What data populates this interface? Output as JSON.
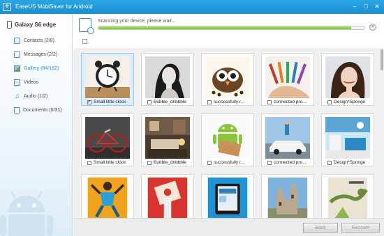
{
  "window": {
    "title": "EaseUS MobiSaver for Android",
    "logo_glyph": "+",
    "controls": {
      "minimize": "–",
      "maximize": "□",
      "close": "✕"
    }
  },
  "sidebar": {
    "device": "Galaxy S6 edge",
    "items": [
      {
        "label": "Contacts (2/8)",
        "icon": "contacts-icon"
      },
      {
        "label": "Messages (2/2)",
        "icon": "messages-icon"
      },
      {
        "label": "Gallery (84/162)",
        "icon": "gallery-icon",
        "active": true
      },
      {
        "label": "Videos",
        "icon": "videos-icon"
      },
      {
        "label": "Audio (1/2)",
        "icon": "audio-icon"
      },
      {
        "label": "Documents (0/31)",
        "icon": "documents-icon"
      }
    ]
  },
  "scan": {
    "status": "Scanning your device, please wait...",
    "progress": 0.95,
    "cancel_glyph": "×"
  },
  "gallery": {
    "items": [
      {
        "caption": "Small little clock",
        "checked": true
      },
      {
        "caption": "Bubble_dribbble",
        "checked": false
      },
      {
        "caption": "successfully r...",
        "checked": false
      },
      {
        "caption": "connected pro...",
        "checked": false
      },
      {
        "caption": "Design*Sponge",
        "checked": false
      },
      {
        "caption": "Small little clock",
        "checked": false
      },
      {
        "caption": "Bubble_dribbble",
        "checked": false
      },
      {
        "caption": "successfully r...",
        "checked": false
      },
      {
        "caption": "connected pro...",
        "checked": false
      },
      {
        "caption": "Design*Sponge",
        "checked": false
      }
    ]
  },
  "buttons": {
    "back": "Back",
    "recover": "Recover"
  },
  "colors": {
    "titlebar": "#1b8fd1",
    "accent": "#1b8fd1",
    "progress": "#7cbf2e",
    "selected_tile": "#dcefff"
  }
}
